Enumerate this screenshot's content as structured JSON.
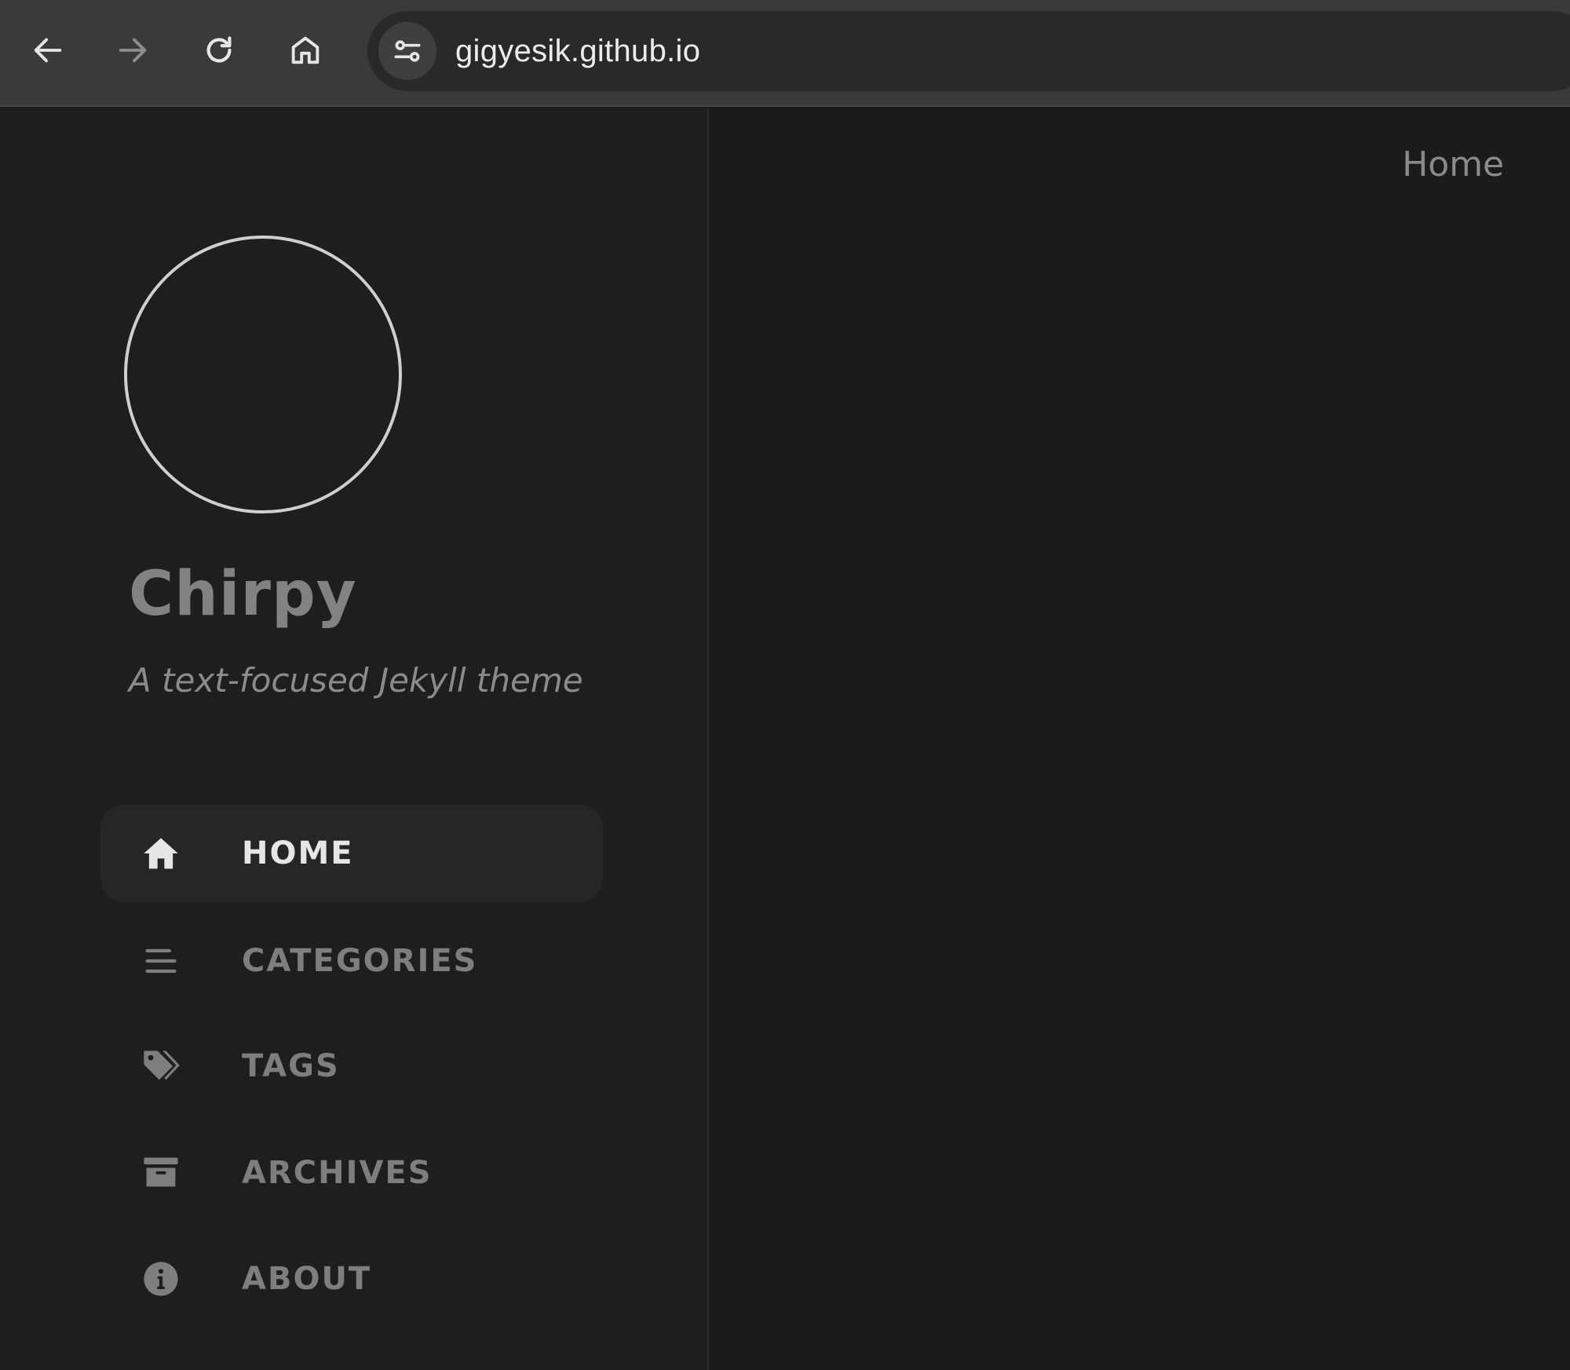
{
  "browser": {
    "url": "gigyesik.github.io",
    "buttons": {
      "back_icon": "arrow-left-icon",
      "forward_icon": "arrow-right-icon",
      "reload_icon": "reload-icon",
      "home_icon": "home-outline-icon",
      "site_info_icon": "tune-icon"
    },
    "colors": {
      "toolbar_bg": "#3a3a3a",
      "omnibox_bg": "#292929",
      "url_text": "#ececec"
    }
  },
  "sidebar": {
    "title": "Chirpy",
    "subtitle": "A text-focused Jekyll theme",
    "nav": [
      {
        "label": "HOME",
        "icon": "home-icon",
        "active": true
      },
      {
        "label": "CATEGORIES",
        "icon": "list-icon",
        "active": false
      },
      {
        "label": "TAGS",
        "icon": "tags-icon",
        "active": false
      },
      {
        "label": "ARCHIVES",
        "icon": "archive-icon",
        "active": false
      },
      {
        "label": "ABOUT",
        "icon": "info-icon",
        "active": false
      }
    ],
    "colors": {
      "background": "#1e1e20",
      "active_item_bg": "#262628",
      "active_label": "#e6e6e6",
      "inactive_label": "#7e7e7e"
    }
  },
  "main": {
    "breadcrumb": "Home"
  }
}
